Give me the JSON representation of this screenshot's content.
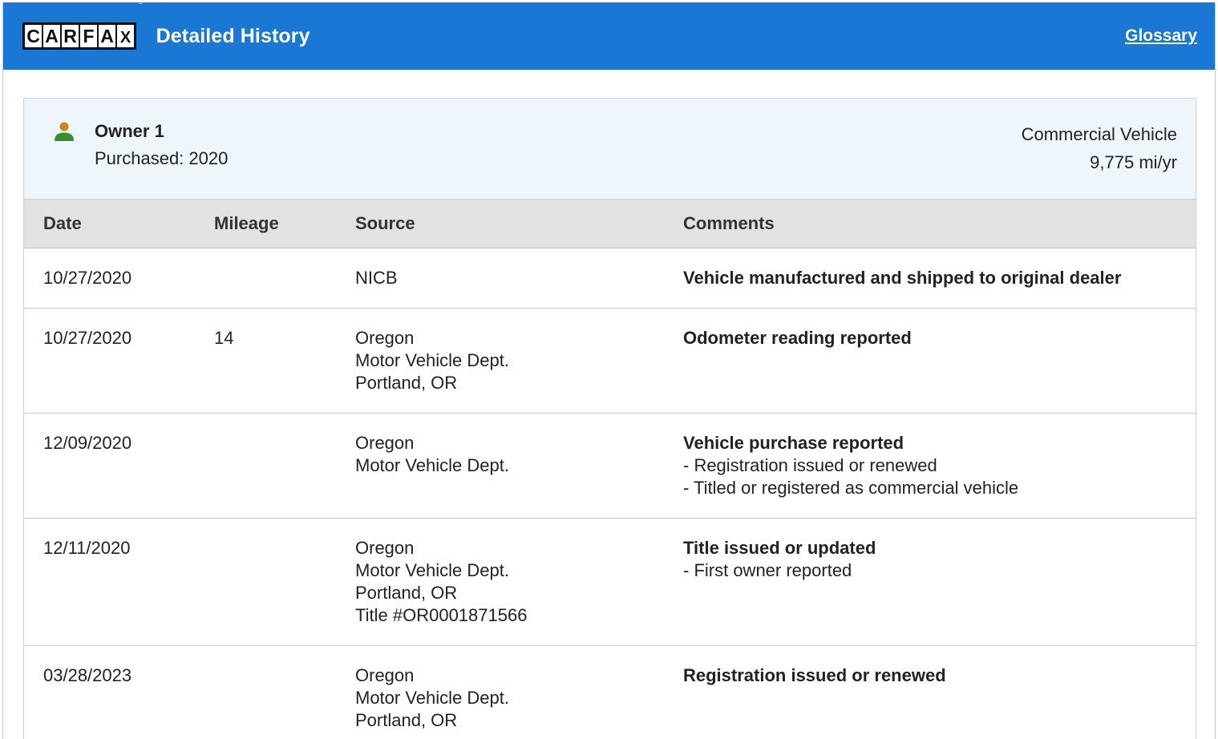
{
  "header": {
    "logo_letters": [
      "C",
      "A",
      "R",
      "F",
      "A",
      "X"
    ],
    "logo_reg": "®",
    "title": "Detailed History",
    "glossary_link": "Glossary",
    "background_color": "#1a77d3"
  },
  "owner": {
    "icon": "person-icon",
    "name": "Owner 1",
    "purchased": "Purchased: 2020",
    "type": "Commercial Vehicle",
    "mileage_rate": "9,775 mi/yr"
  },
  "table": {
    "columns": [
      "Date",
      "Mileage",
      "Source",
      "Comments"
    ],
    "rows": [
      {
        "date": "10/27/2020",
        "mileage": "",
        "source": [
          "NICB"
        ],
        "comment_title": "Vehicle manufactured and shipped to original dealer",
        "comment_lines": []
      },
      {
        "date": "10/27/2020",
        "mileage": "14",
        "source": [
          "Oregon",
          "Motor Vehicle Dept.",
          "Portland, OR"
        ],
        "comment_title": "Odometer reading reported",
        "comment_lines": []
      },
      {
        "date": "12/09/2020",
        "mileage": "",
        "source": [
          "Oregon",
          "Motor Vehicle Dept."
        ],
        "comment_title": "Vehicle purchase reported",
        "comment_lines": [
          "- Registration issued or renewed",
          "- Titled or registered as commercial vehicle"
        ]
      },
      {
        "date": "12/11/2020",
        "mileage": "",
        "source": [
          "Oregon",
          "Motor Vehicle Dept.",
          "Portland, OR",
          "Title #OR0001871566"
        ],
        "comment_title": "Title issued or updated",
        "comment_lines": [
          "- First owner reported"
        ]
      },
      {
        "date": "03/28/2023",
        "mileage": "",
        "source": [
          "Oregon",
          "Motor Vehicle Dept.",
          "Portland, OR"
        ],
        "comment_title": "Registration issued or renewed",
        "comment_lines": []
      }
    ]
  }
}
